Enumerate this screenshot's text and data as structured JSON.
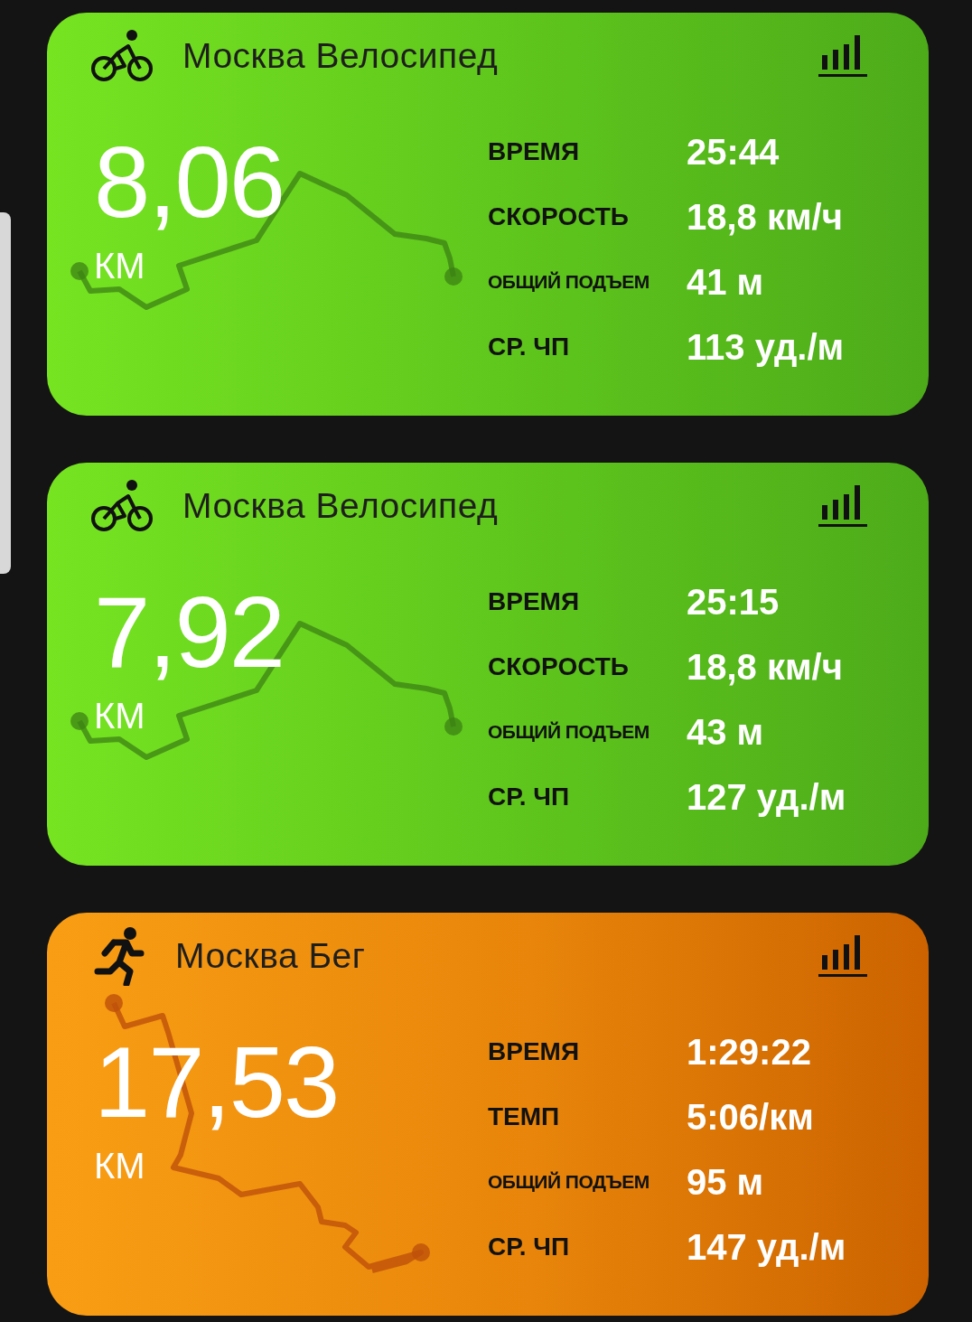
{
  "activities": [
    {
      "kind": "cycling",
      "title": "Москва Велосипед",
      "distance": "8,06",
      "unit": "КМ",
      "stats": [
        {
          "label": "ВРЕМЯ",
          "value": "25:44",
          "compact": false
        },
        {
          "label": "СКОРОСТЬ",
          "value": "18,8 км/ч",
          "compact": false
        },
        {
          "label": "ОБЩИЙ ПОДЪЕМ",
          "value": "41 м",
          "compact": true
        },
        {
          "label": "СР. ЧП",
          "value": "113 уд./м",
          "compact": false
        }
      ]
    },
    {
      "kind": "cycling",
      "title": "Москва Велосипед",
      "distance": "7,92",
      "unit": "КМ",
      "stats": [
        {
          "label": "ВРЕМЯ",
          "value": "25:15",
          "compact": false
        },
        {
          "label": "СКОРОСТЬ",
          "value": "18,8 км/ч",
          "compact": false
        },
        {
          "label": "ОБЩИЙ ПОДЪЕМ",
          "value": "43 м",
          "compact": true
        },
        {
          "label": "СР. ЧП",
          "value": "127 уд./м",
          "compact": false
        }
      ]
    },
    {
      "kind": "running",
      "title": "Москва Бег",
      "distance": "17,53",
      "unit": "КМ",
      "stats": [
        {
          "label": "ВРЕМЯ",
          "value": "1:29:22",
          "compact": false
        },
        {
          "label": "ТЕМП",
          "value": "5:06/км",
          "compact": false
        },
        {
          "label": "ОБЩИЙ ПОДЪЕМ",
          "value": "95 м",
          "compact": true
        },
        {
          "label": "СР. ЧП",
          "value": "147 уд./м",
          "compact": false
        }
      ]
    }
  ]
}
